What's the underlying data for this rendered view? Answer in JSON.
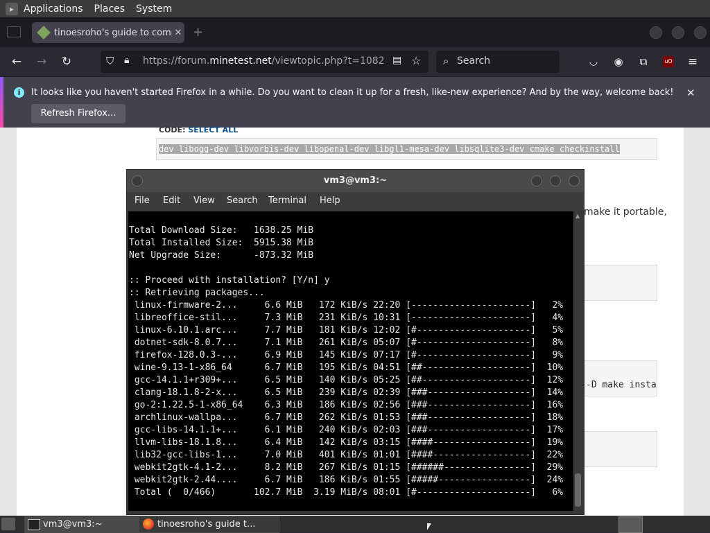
{
  "top_panel": {
    "menus": [
      "Applications",
      "Places",
      "System"
    ]
  },
  "firefox": {
    "tab_title": "tinoesroho's guide to comp",
    "url_prefix": "https://forum.",
    "url_domain": "minetest.net",
    "url_path": "/viewtopic.php?t=1082",
    "search_placeholder": "Search",
    "notification": {
      "message": "It looks like you haven't started Firefox in a while. Do you want to clean it up for a fresh, like-new experience? And by the way, welcome back!",
      "button": "Refresh Firefox..."
    }
  },
  "page": {
    "code_label": "CODE:",
    "select_all": "SELECT ALL",
    "code_line": "dev libogg-dev libvorbis-dev libopenal-dev libgl1-mesa-dev libsqlite3-dev cmake checkinstall",
    "text_right": "make it portable,",
    "code_right": "-D make insta"
  },
  "terminal": {
    "title": "vm3@vm3:~",
    "menu": [
      "File",
      "Edit",
      "View",
      "Search",
      "Terminal",
      "Help"
    ],
    "lines": [
      "Total Download Size:   1638.25 MiB",
      "Total Installed Size:  5915.38 MiB",
      "Net Upgrade Size:      -873.32 MiB",
      "",
      ":: Proceed with installation? [Y/n] y",
      ":: Retrieving packages...",
      " linux-firmware-2...     6.6 MiB   172 KiB/s 22:20 [----------------------]   2%",
      " libreoffice-stil...     7.3 MiB   231 KiB/s 10:31 [----------------------]   4%",
      " linux-6.10.1.arc...     7.7 MiB   181 KiB/s 12:02 [#---------------------]   5%",
      " dotnet-sdk-8.0.7...     7.1 MiB   261 KiB/s 05:07 [#---------------------]   8%",
      " firefox-128.0.3-...     6.9 MiB   145 KiB/s 07:17 [#---------------------]   9%",
      " wine-9.13-1-x86_64      6.7 MiB   195 KiB/s 04:51 [##--------------------]  10%",
      " gcc-14.1.1+r309+...     6.5 MiB   140 KiB/s 05:25 [##--------------------]  12%",
      " clang-18.1.8-2-x...     6.5 MiB   239 KiB/s 02:39 [###-------------------]  14%",
      " go-2:1.22.5-1-x86_64    6.3 MiB   186 KiB/s 02:56 [###-------------------]  16%",
      " archlinux-wallpa...     6.7 MiB   262 KiB/s 01:53 [###-------------------]  18%",
      " gcc-libs-14.1.1+...     6.1 MiB   240 KiB/s 02:03 [###-------------------]  17%",
      " llvm-libs-18.1.8...     6.4 MiB   142 KiB/s 03:15 [####------------------]  19%",
      " lib32-gcc-libs-1...     7.0 MiB   401 KiB/s 01:01 [####------------------]  22%",
      " webkit2gtk-4.1-2...     8.2 MiB   267 KiB/s 01:15 [######----------------]  29%",
      " webkit2gtk-2.44....     6.7 MiB   186 KiB/s 01:55 [#####-----------------]  24%",
      " Total (  0/466)       102.7 MiB  3.19 MiB/s 08:01 [#---------------------]   6%"
    ]
  },
  "taskbar": {
    "terminal_item": "vm3@vm3:~",
    "firefox_item": "tinoesroho's guide t..."
  }
}
